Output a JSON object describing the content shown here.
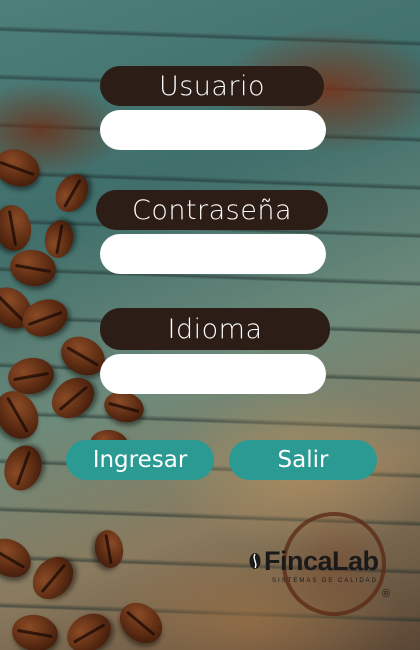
{
  "form": {
    "user_label": "Usuario",
    "user_value": "",
    "password_label": "Contraseña",
    "password_value": "",
    "language_label": "Idioma",
    "language_value": ""
  },
  "actions": {
    "login_label": "Ingresar",
    "exit_label": "Salir"
  },
  "branding": {
    "logo_text": "FincaLab",
    "logo_tagline": "SISTEMAS DE CALIDAD",
    "registered_mark": "®"
  },
  "colors": {
    "label_bg": "#2c1d17",
    "button_bg": "#2a9a92",
    "field_bg": "#ffffff"
  }
}
